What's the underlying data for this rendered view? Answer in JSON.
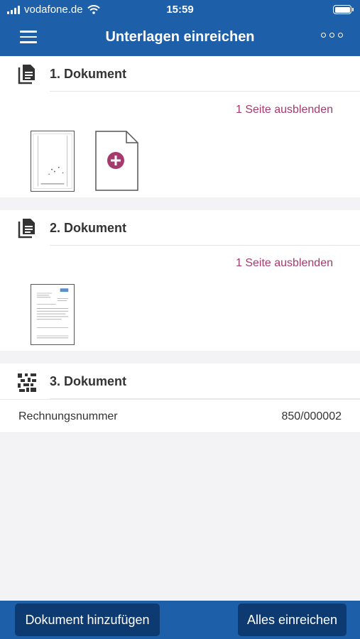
{
  "status_bar": {
    "carrier": "vodafone.de",
    "time": "15:59"
  },
  "header": {
    "title": "Unterlagen einreichen",
    "menu_icon": "hamburger-menu-icon",
    "more_icon": "more-options-icon"
  },
  "documents": [
    {
      "title": "1. Dokument",
      "toggle_label": "1 Seite ausblenden",
      "icon": "document-copy-icon"
    },
    {
      "title": "2. Dokument",
      "toggle_label": "1 Seite ausblenden",
      "icon": "document-copy-icon"
    },
    {
      "title": "3. Dokument",
      "icon": "qr-code-icon",
      "fields": [
        {
          "label": "Rechnungsnummer",
          "value": "850/000002"
        }
      ]
    }
  ],
  "footer": {
    "add_label": "Dokument hinzufügen",
    "submit_label": "Alles einreichen"
  },
  "colors": {
    "primary": "#1d5fa8",
    "button": "#0d3a70",
    "accent": "#a43a6e"
  }
}
